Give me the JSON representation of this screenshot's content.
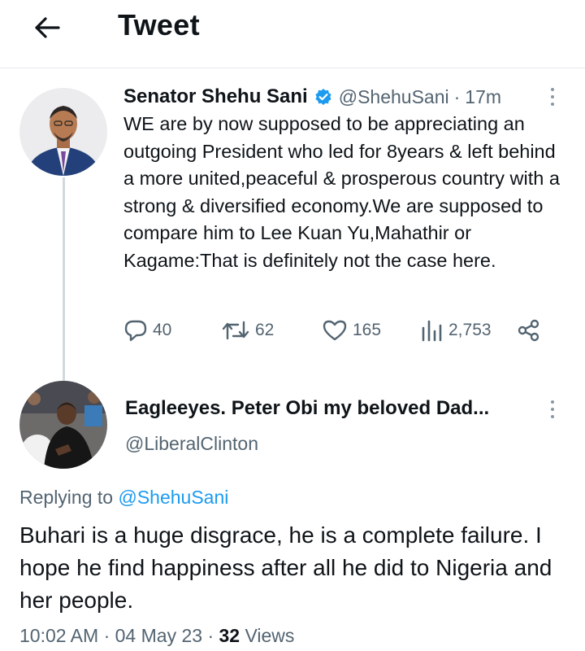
{
  "header": {
    "title": "Tweet",
    "back_icon": "arrow-left-icon"
  },
  "original_tweet": {
    "author_name": "Senator Shehu Sani",
    "verified": true,
    "verified_color": "#1d9bf0",
    "handle": "@ShehuSani",
    "separator": "·",
    "time": "17m",
    "text": "WE are by now supposed to be appreciating an outgoing President who led for 8years & left behind a more united,peaceful & prosperous country with a strong & diversified economy.We are supposed to compare him to Lee Kuan Yu,Mahathir or Kagame:That is definitely not the case here.",
    "actions": {
      "replies": "40",
      "retweets": "62",
      "likes": "165",
      "views": "2,753"
    }
  },
  "reply_tweet": {
    "author_name": "Eagleeyes. Peter Obi my beloved Dad...",
    "handle": "@LiberalClinton",
    "replying_prefix": "Replying to",
    "replying_to": "@ShehuSani",
    "text": "Buhari is a huge disgrace, he is a complete failure. I hope he find happiness after all he did to Nigeria and her people.",
    "time": "10:02 AM",
    "separator": "·",
    "date": "04 May 23",
    "views_count": "32",
    "views_label": "Views"
  },
  "colors": {
    "accent": "#1d9bf0",
    "text": "#0f1419",
    "muted": "#536471",
    "divider": "#e6e9ec"
  }
}
